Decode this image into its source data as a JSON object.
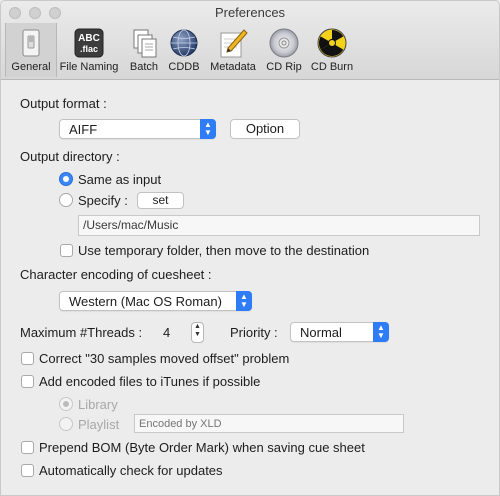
{
  "window": {
    "title": "Preferences"
  },
  "toolbar": {
    "tabs": [
      {
        "label": "General",
        "icon": "switch-icon",
        "selected": true
      },
      {
        "label": "File Naming",
        "icon": "abc-flac-icon",
        "icon_text_1": "ABC",
        "icon_text_2": ".flac"
      },
      {
        "label": "Batch",
        "icon": "documents-icon"
      },
      {
        "label": "CDDB",
        "icon": "globe-icon"
      },
      {
        "label": "Metadata",
        "icon": "pencil-icon"
      },
      {
        "label": "CD Rip",
        "icon": "cd-icon"
      },
      {
        "label": "CD Burn",
        "icon": "radiation-icon"
      }
    ]
  },
  "general": {
    "output_format_label": "Output format :",
    "output_format_value": "AIFF",
    "option_button": "Option",
    "output_directory_label": "Output directory :",
    "same_as_input": "Same as input",
    "specify": "Specify :",
    "set_button": "set",
    "directory_path": "/Users/mac/Music",
    "temp_folder": "Use temporary folder, then move to the destination",
    "char_encoding_label": "Character encoding of cuesheet :",
    "char_encoding_value": "Western (Mac OS Roman)",
    "max_threads_label": "Maximum #Threads :",
    "max_threads_value": "4",
    "priority_label": "Priority :",
    "priority_value": "Normal",
    "correct_offset": "Correct \"30 samples moved offset\" problem",
    "add_itunes": "Add encoded files to iTunes if possible",
    "library": "Library",
    "playlist": "Playlist",
    "playlist_placeholder": "Encoded by XLD",
    "prepend_bom": "Prepend BOM (Byte Order Mark) when saving cue sheet",
    "auto_update": "Automatically check for updates"
  },
  "colors": {
    "accent": "#2e7cf6",
    "window_bg": "#ececec"
  }
}
